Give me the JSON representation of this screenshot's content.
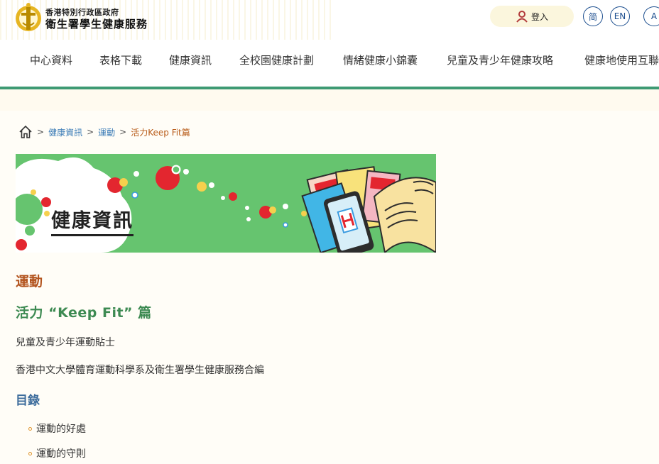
{
  "header": {
    "org_small": "香港特別行政區政府",
    "org_big": "衛生署學生健康服務",
    "login_label": "登入",
    "lang_simplified": "简",
    "lang_english": "EN",
    "font_size_label": "A"
  },
  "nav": {
    "items": [
      "中心資料",
      "表格下載",
      "健康資訊",
      "全校園健康計劃",
      "情緒健康小錦囊",
      "兒童及青少年健康攻略",
      "健康地使用互聯"
    ]
  },
  "breadcrumb": {
    "sep": ">",
    "items": [
      "健康資訊",
      "運動",
      "活力Keep Fit篇"
    ]
  },
  "banner": {
    "title": "健康資訊"
  },
  "content": {
    "section_title": "運動",
    "page_title": "活力 “Keep Fit” 篇",
    "subtitle": "兒童及青少年運動貼士",
    "credit": "香港中文大學體育運動科學系及衛生署學生健康服務合編",
    "toc_title": "目錄",
    "toc_items": [
      "運動的好處",
      "運動的守則"
    ]
  },
  "colors": {
    "accent_green": "#3e9a73",
    "banner_green": "#66c46f",
    "section_orange": "#b3541e",
    "title_green": "#3d8a52",
    "toc_blue": "#3d6c9c",
    "link_blue": "#3a7bb6"
  }
}
